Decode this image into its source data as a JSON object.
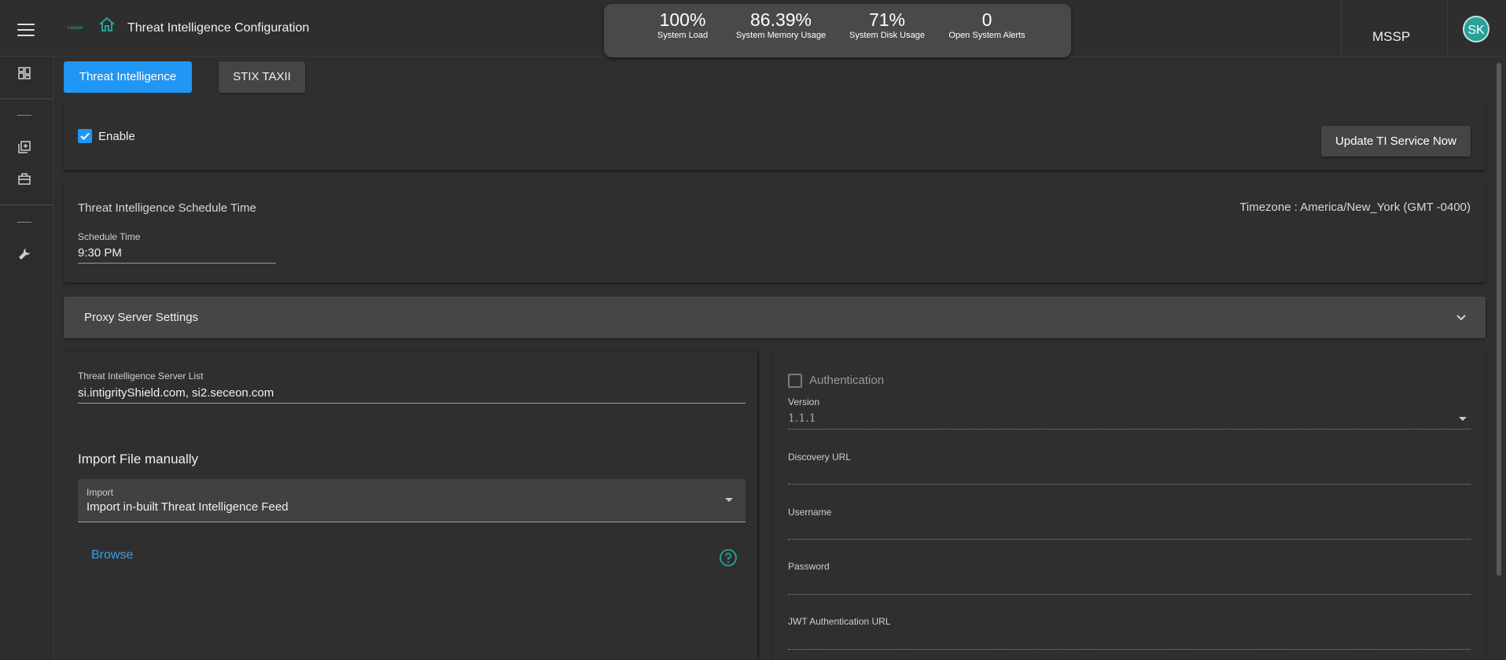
{
  "header": {
    "logo_text": "i-secon",
    "title": "Threat Intelligence Configuration",
    "stats": [
      {
        "value": "100%",
        "label": "System Load"
      },
      {
        "value": "86.39%",
        "label": "System Memory Usage"
      },
      {
        "value": "71%",
        "label": "System Disk Usage"
      },
      {
        "value": "0",
        "label": "Open System Alerts"
      }
    ],
    "tenant": "MSSP",
    "avatar_initials": "SK"
  },
  "tabs": [
    {
      "label": "Threat Intelligence",
      "active": true
    },
    {
      "label": "STIX TAXII",
      "active": false
    }
  ],
  "enable_card": {
    "checkbox_label": "Enable",
    "checked": true,
    "update_button": "Update TI Service Now"
  },
  "schedule_card": {
    "heading": "Threat Intelligence Schedule Time",
    "timezone": "Timezone : America/New_York (GMT -0400)",
    "field_label": "Schedule Time",
    "field_value": "9:30 PM"
  },
  "proxy": {
    "title": "Proxy Server Settings"
  },
  "left_panel": {
    "server_list_label": "Threat Intelligence Server List",
    "server_list_value": "si.intigrityShield.com, si2.seceon.com",
    "import_heading": "Import File manually",
    "import_label": "Import",
    "import_value": "Import in-built Threat Intelligence Feed",
    "browse_label": "Browse"
  },
  "right_panel": {
    "auth_label": "Authentication",
    "auth_checked": false,
    "version_label": "Version",
    "version_value": "1.1.1",
    "discovery_label": "Discovery URL",
    "username_label": "Username",
    "password_label": "Password",
    "jwt_label": "JWT Authentication URL"
  },
  "colors": {
    "accent": "#2196f3",
    "teal": "#2aa196",
    "background": "#2f2f2f"
  }
}
